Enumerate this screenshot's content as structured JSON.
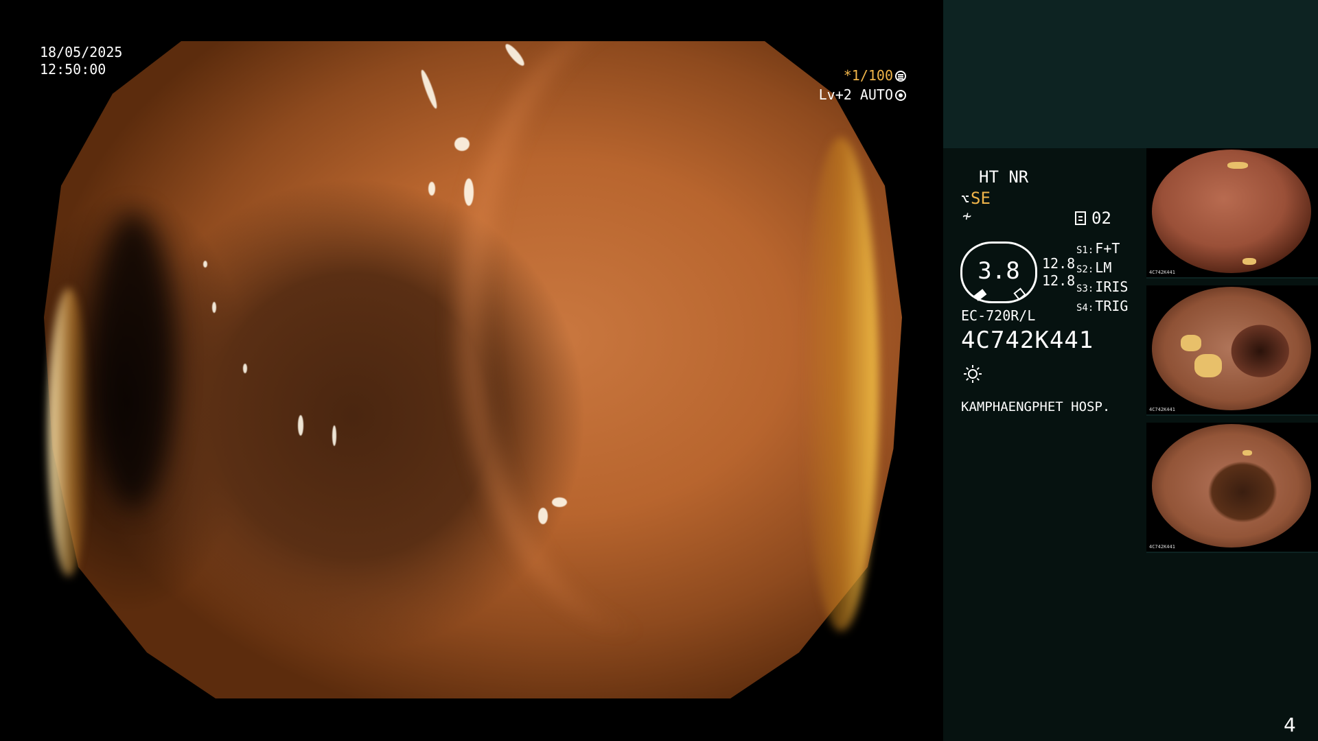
{
  "overlay": {
    "date": "18/05/2025",
    "time": "12:50:00",
    "shutter": "*1/100",
    "level": "Lv+2 AUTO"
  },
  "panel": {
    "ht_nr": "HT NR",
    "se": "SE",
    "count": "02",
    "gauge_value": "3.8",
    "gauge_nums": [
      "12.8",
      "12.8"
    ],
    "switches": [
      {
        "key": "S1:",
        "value": "F+T"
      },
      {
        "key": "S2:",
        "value": "LM"
      },
      {
        "key": "S3:",
        "value": "IRIS"
      },
      {
        "key": "S4:",
        "value": "TRIG"
      }
    ],
    "scope_model": "EC-720R/L",
    "serial": "4C742K441",
    "hospital": "KAMPHAENGPHET HOSP."
  },
  "thumbnails": [
    {
      "label": "4C742K441"
    },
    {
      "label": "4C742K441"
    },
    {
      "label": "4C742K441"
    }
  ],
  "page_number": "4",
  "icons": {
    "shutter_icon": "aperture-icon",
    "auto_icon": "iris-icon",
    "tool_icon": "scope-tool-icon",
    "slash_icon": "structure-enhance-icon",
    "doc_icon": "memory-icon",
    "sun_icon": "brightness-icon"
  },
  "colors": {
    "accent": "#f0b54a",
    "panel_bg": "#061210",
    "panel_top_bg": "#0d2322"
  }
}
